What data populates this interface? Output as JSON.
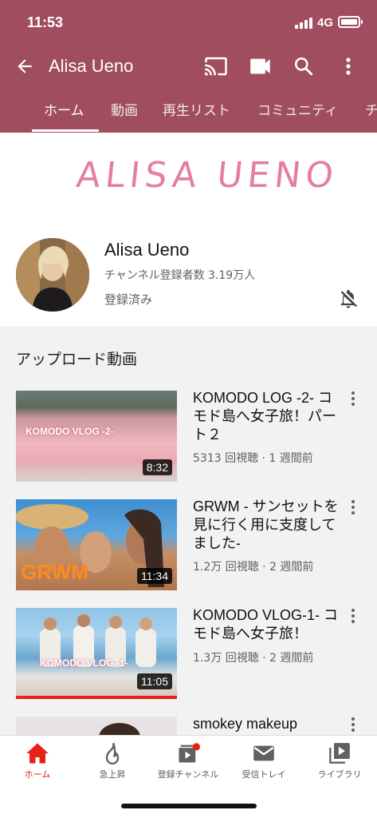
{
  "status": {
    "time": "11:53",
    "network": "4G"
  },
  "appbar": {
    "title": "Alisa Ueno"
  },
  "tabs": [
    {
      "label": "ホーム"
    },
    {
      "label": "動画"
    },
    {
      "label": "再生リスト"
    },
    {
      "label": "コミュニティ"
    },
    {
      "label": "チ"
    }
  ],
  "banner": {
    "text": "ALISA UENO"
  },
  "channel": {
    "name": "Alisa Ueno",
    "subscribers": "チャンネル登録者数 3.19万人",
    "state": "登録済み"
  },
  "uploads": {
    "heading": "アップロード動画",
    "videos": [
      {
        "title": "KOMODO LOG -2- コモド島へ女子旅！パート２",
        "meta": "5313 回視聴 · 1 週間前",
        "duration": "8:32",
        "thumb_text": "KOMODO VLOG -2-"
      },
      {
        "title": "GRWM - サンセットを見に行く用に支度してました-",
        "meta": "1.2万 回視聴 · 2 週間前",
        "duration": "11:34",
        "thumb_text": "GRWM"
      },
      {
        "title": "KOMODO VLOG-1- コモド島へ女子旅！",
        "meta": "1.3万 回視聴 · 2 週間前",
        "duration": "11:05",
        "thumb_text": "KOMODO VLOG -1-",
        "watched_fraction": 1.0
      },
      {
        "title": "smokey makeup"
      }
    ]
  },
  "bottom_nav": [
    {
      "label": "ホーム",
      "icon": "home-icon"
    },
    {
      "label": "急上昇",
      "icon": "flame-icon"
    },
    {
      "label": "登録チャンネル",
      "icon": "subscriptions-icon"
    },
    {
      "label": "受信トレイ",
      "icon": "mail-icon"
    },
    {
      "label": "ライブラリ",
      "icon": "library-icon"
    }
  ],
  "colors": {
    "header": "#a04d60",
    "accent": "#e62117",
    "banner_text": "#e57f9c"
  }
}
